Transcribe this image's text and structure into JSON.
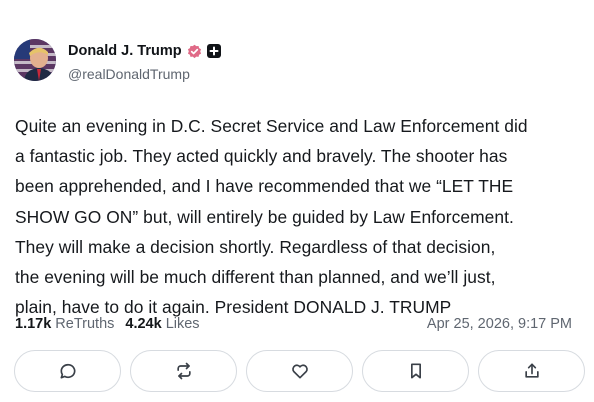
{
  "author": {
    "display_name": "Donald J. Trump",
    "handle": "@realDonaldTrump",
    "avatar_icon": "avatar-flag-portrait",
    "verified_icon": "verified-badge-icon",
    "verified_color": "#e06a87",
    "extra_badge_icon": "plus-badge-icon"
  },
  "post": {
    "lines": [
      "Quite an evening in D.C. Secret Service and Law Enforcement did",
      "a fantastic job. They acted quickly and bravely. The shooter has",
      "been apprehended, and I have recommended that we “LET THE",
      "SHOW GO ON” but, will entirely be guided by Law Enforcement.",
      "They will make a decision shortly. Regardless of that decision,",
      "the evening will be much different than planned, and we’ll just,",
      "plain, have to do it again. President DONALD J. TRUMP"
    ]
  },
  "stats": {
    "retruths_count": "1.17k",
    "retruths_label": "ReTruths",
    "likes_count": "4.24k",
    "likes_label": "Likes",
    "timestamp": "Apr 25, 2026, 9:17 PM"
  },
  "actions": [
    {
      "name": "reply-button",
      "icon": "comment-icon"
    },
    {
      "name": "retruth-button",
      "icon": "repost-icon"
    },
    {
      "name": "like-button",
      "icon": "heart-icon"
    },
    {
      "name": "bookmark-button",
      "icon": "bookmark-icon"
    },
    {
      "name": "share-button",
      "icon": "share-icon"
    }
  ]
}
